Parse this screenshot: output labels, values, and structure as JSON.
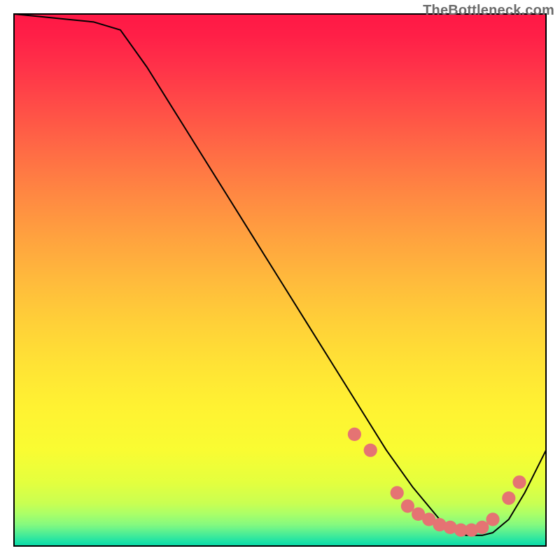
{
  "watermark": "TheBottleneck.com",
  "chart_data": {
    "type": "line",
    "title": "",
    "xlabel": "",
    "ylabel": "",
    "xlim": [
      0,
      100
    ],
    "ylim": [
      0,
      100
    ],
    "series": [
      {
        "name": "curve",
        "x": [
          0,
          5,
          10,
          15,
          20,
          25,
          30,
          35,
          40,
          45,
          50,
          55,
          60,
          65,
          70,
          75,
          80,
          82,
          85,
          88,
          90,
          93,
          96,
          100
        ],
        "values": [
          100,
          99.5,
          99,
          98.5,
          97,
          90,
          82,
          74,
          66,
          58,
          50,
          42,
          34,
          26,
          18,
          11,
          5,
          3,
          2,
          2,
          2.5,
          5,
          10,
          18
        ]
      }
    ],
    "markers": {
      "name": "markers",
      "x": [
        64,
        67,
        72,
        74,
        76,
        78,
        80,
        82,
        84,
        86,
        88,
        90,
        93,
        95
      ],
      "values": [
        21,
        18,
        10,
        7.5,
        6,
        5,
        4,
        3.5,
        3,
        3,
        3.5,
        5,
        9,
        12
      ],
      "color": "#e57373",
      "radius_pct": 1.2
    },
    "gradient_stops": [
      {
        "offset": 0.0,
        "color": "#ff1846"
      },
      {
        "offset": 0.04,
        "color": "#ff1f47"
      },
      {
        "offset": 0.1,
        "color": "#ff3249"
      },
      {
        "offset": 0.18,
        "color": "#ff4f47"
      },
      {
        "offset": 0.26,
        "color": "#ff6c45"
      },
      {
        "offset": 0.34,
        "color": "#ff8842"
      },
      {
        "offset": 0.42,
        "color": "#ffa23f"
      },
      {
        "offset": 0.5,
        "color": "#ffba3c"
      },
      {
        "offset": 0.58,
        "color": "#ffd038"
      },
      {
        "offset": 0.66,
        "color": "#ffe335"
      },
      {
        "offset": 0.74,
        "color": "#fff232"
      },
      {
        "offset": 0.82,
        "color": "#f9fc32"
      },
      {
        "offset": 0.88,
        "color": "#e4ff3e"
      },
      {
        "offset": 0.92,
        "color": "#c9ff52"
      },
      {
        "offset": 0.94,
        "color": "#aaff68"
      },
      {
        "offset": 0.96,
        "color": "#84f97f"
      },
      {
        "offset": 0.975,
        "color": "#54ef93"
      },
      {
        "offset": 0.99,
        "color": "#22e3a4"
      },
      {
        "offset": 1.0,
        "color": "#07d9a8"
      }
    ],
    "frame": {
      "inset_pct": 2.5,
      "stroke": "#000000",
      "stroke_width": 2
    },
    "line_style": {
      "stroke": "#000000",
      "stroke_width": 2
    }
  }
}
